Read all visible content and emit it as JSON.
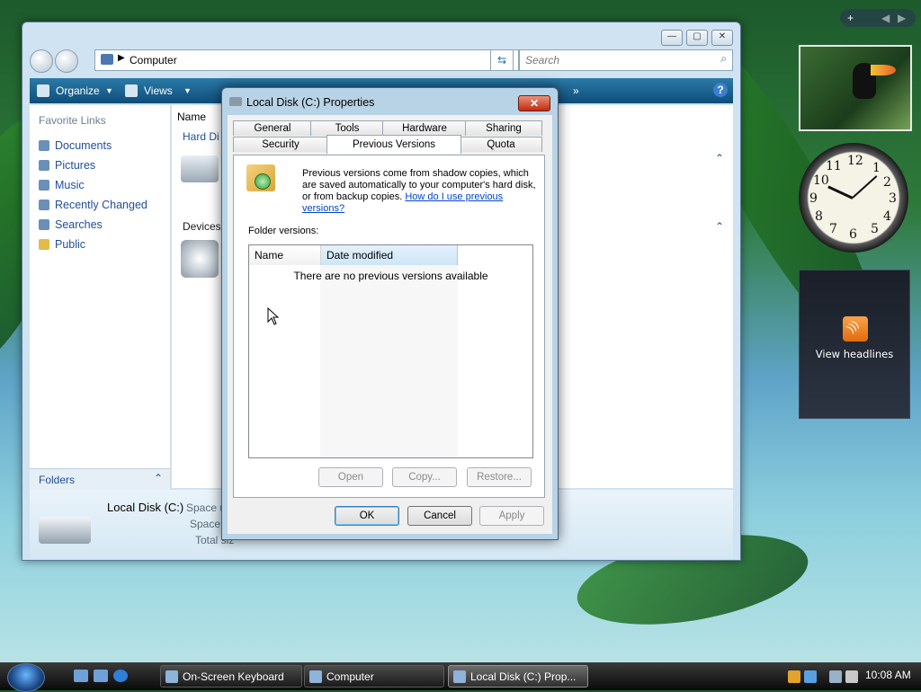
{
  "explorer": {
    "address_crumb": "Computer",
    "search_placeholder": "Search",
    "toolbar": {
      "organize": "Organize",
      "views": "Views"
    },
    "favorite_links_title": "Favorite Links",
    "favorites": [
      "Documents",
      "Pictures",
      "Music",
      "Recently Changed",
      "Searches",
      "Public"
    ],
    "folders_label": "Folders",
    "content": {
      "name_column": "Name",
      "group_hard_disks": "Hard Di",
      "group_devices": "Devices"
    },
    "details": {
      "name": "Local Disk (C:)",
      "space_used": "Space us",
      "space_free": "Space fr",
      "total_size": "Total siz"
    }
  },
  "dialog": {
    "title": "Local Disk (C:) Properties",
    "close_glyph": "✕",
    "tabs_row1": [
      "General",
      "Tools",
      "Hardware",
      "Sharing"
    ],
    "tabs_row2": [
      "Security",
      "Previous Versions",
      "Quota"
    ],
    "active_tab": "Previous Versions",
    "description": "Previous versions come from shadow copies, which are saved automatically to your computer's hard disk, or from backup copies.",
    "help_link": "How do I use previous versions?",
    "folder_versions_label": "Folder versions:",
    "columns": [
      "Name",
      "Date modified"
    ],
    "empty_message": "There are no previous versions available",
    "action_buttons": {
      "open": "Open",
      "copy": "Copy...",
      "restore": "Restore..."
    },
    "footer_buttons": {
      "ok": "OK",
      "cancel": "Cancel",
      "apply": "Apply"
    }
  },
  "gadgets": {
    "sidebar_add": "+",
    "clock_numbers": [
      "12",
      "1",
      "2",
      "3",
      "4",
      "5",
      "6",
      "7",
      "8",
      "9",
      "10",
      "11"
    ],
    "feed_text": "View headlines"
  },
  "taskbar": {
    "tasks": [
      "On-Screen Keyboard",
      "Computer",
      "Local Disk (C:) Prop..."
    ],
    "time": "10:08 AM"
  },
  "colors": {
    "toolbar": "#0f4d7a",
    "link": "#1f4e9a",
    "dialog_frame": "#b9d3e6",
    "close_button": "#c22a10"
  }
}
